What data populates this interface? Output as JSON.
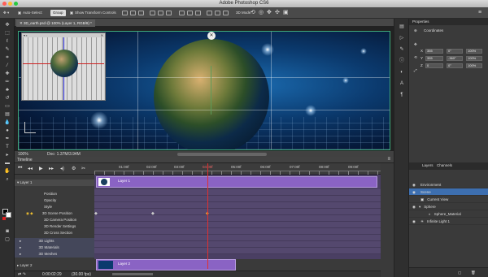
{
  "app": {
    "title": "Adobe Photoshop CS6"
  },
  "options_bar": {
    "auto_select_label": "Auto-Select:",
    "auto_select_value": "Group",
    "show_transform_label": "Show Transform Controls",
    "mode_label": "3D Mode:"
  },
  "document": {
    "tab_label": "3D_earth.psd @ 100% (Layer 1, RGB/8) *",
    "zoom": "100%",
    "doc_size": "Doc: 1.37M/3.94M"
  },
  "timeline": {
    "panel_label": "Timeline",
    "ruler_labels": [
      "01:00f",
      "02:00f",
      "03:00f",
      "04:00f",
      "05:00f",
      "06:00f",
      "07:00f",
      "08:00f",
      "09:00f"
    ],
    "layers": [
      {
        "label": "Layer 1",
        "indent": 0,
        "expanded": true,
        "stopwatch": false
      },
      {
        "label": "Position",
        "indent": 1,
        "stopwatch": false
      },
      {
        "label": "Opacity",
        "indent": 1,
        "stopwatch": false
      },
      {
        "label": "Style",
        "indent": 1,
        "stopwatch": false
      },
      {
        "label": "3D Scene Position",
        "indent": 1,
        "stopwatch": true
      },
      {
        "label": "3D Camera Position",
        "indent": 1,
        "stopwatch": false
      },
      {
        "label": "3D Render Settings",
        "indent": 1,
        "stopwatch": false
      },
      {
        "label": "3D Cross Section",
        "indent": 1,
        "stopwatch": false
      },
      {
        "label": "3D Lights",
        "indent": 1,
        "group": true
      },
      {
        "label": "3D Materials",
        "indent": 1,
        "group": true
      },
      {
        "label": "3D Meshes",
        "indent": 1,
        "group": true
      },
      {
        "label": "Layer 2",
        "indent": 0,
        "expanded": false
      }
    ],
    "clip1_label": "Layer 1",
    "clip2_label": "Layer 2",
    "timecode": "0:00:02:29",
    "fps": "(30.00 fps)"
  },
  "properties": {
    "tab_label": "Properties",
    "section_label": "Coordinates",
    "fields": [
      {
        "axis": "X",
        "pos": "355",
        "rot": "0°",
        "scale": "100%"
      },
      {
        "axis": "Y",
        "pos": "355",
        "rot": "-360°",
        "scale": "100%"
      },
      {
        "axis": "Z",
        "pos": "0",
        "rot": "0°",
        "scale": "100%"
      }
    ]
  },
  "layers_panel": {
    "tabs": [
      "Layers",
      "Channels"
    ],
    "items": [
      {
        "label": "Environment",
        "indent": 0,
        "selected": false
      },
      {
        "label": "Scene",
        "indent": 0,
        "selected": true
      },
      {
        "label": "Current View",
        "indent": 1,
        "selected": false
      },
      {
        "label": "Sphere",
        "indent": 1,
        "selected": false
      },
      {
        "label": "Sphere_Material",
        "indent": 2,
        "selected": false
      },
      {
        "label": "Infinite Light 1",
        "indent": 1,
        "selected": false
      }
    ]
  },
  "colors": {
    "clip": "#8a63c4",
    "playhead": "#e03030",
    "selection": "#3d6fb0",
    "canvas_border": "#3fa87a"
  }
}
